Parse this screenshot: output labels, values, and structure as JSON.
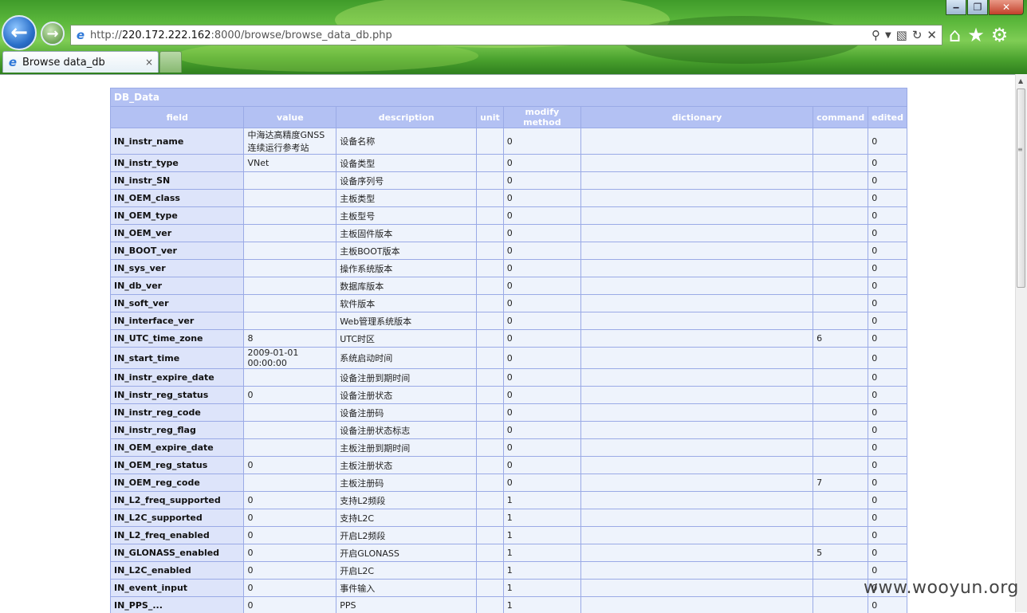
{
  "browser": {
    "url_prefix": "http://",
    "url_host": "220.172.222.162",
    "url_rest": ":8000/browse/browse_data_db.php",
    "tab_title": "Browse data_db",
    "tab_close": "×"
  },
  "table": {
    "caption": "DB_Data",
    "headers": [
      "field",
      "value",
      "description",
      "unit",
      "modify method",
      "dictionary",
      "command",
      "edited"
    ],
    "rows": [
      [
        "IN_instr_name",
        "中海达高精度GNSS连续运行参考站",
        "设备名称",
        "",
        "0",
        "",
        "",
        "0"
      ],
      [
        "IN_instr_type",
        "VNet",
        "设备类型",
        "",
        "0",
        "",
        "",
        "0"
      ],
      [
        "IN_instr_SN",
        "",
        "设备序列号",
        "",
        "0",
        "",
        "",
        "0"
      ],
      [
        "IN_OEM_class",
        "",
        "主板类型",
        "",
        "0",
        "",
        "",
        "0"
      ],
      [
        "IN_OEM_type",
        "",
        "主板型号",
        "",
        "0",
        "",
        "",
        "0"
      ],
      [
        "IN_OEM_ver",
        "",
        "主板固件版本",
        "",
        "0",
        "",
        "",
        "0"
      ],
      [
        "IN_BOOT_ver",
        "",
        "主板BOOT版本",
        "",
        "0",
        "",
        "",
        "0"
      ],
      [
        "IN_sys_ver",
        "",
        "操作系统版本",
        "",
        "0",
        "",
        "",
        "0"
      ],
      [
        "IN_db_ver",
        "",
        "数据库版本",
        "",
        "0",
        "",
        "",
        "0"
      ],
      [
        "IN_soft_ver",
        "",
        "软件版本",
        "",
        "0",
        "",
        "",
        "0"
      ],
      [
        "IN_interface_ver",
        "",
        "Web管理系统版本",
        "",
        "0",
        "",
        "",
        "0"
      ],
      [
        "IN_UTC_time_zone",
        "8",
        "UTC时区",
        "",
        "0",
        "",
        "6",
        "0"
      ],
      [
        "IN_start_time",
        "2009-01-01 00:00:00",
        "系统启动时间",
        "",
        "0",
        "",
        "",
        "0"
      ],
      [
        "IN_instr_expire_date",
        "",
        "设备注册到期时间",
        "",
        "0",
        "",
        "",
        "0"
      ],
      [
        "IN_instr_reg_status",
        "0",
        "设备注册状态",
        "",
        "0",
        "",
        "",
        "0"
      ],
      [
        "IN_instr_reg_code",
        "",
        "设备注册码",
        "",
        "0",
        "",
        "",
        "0"
      ],
      [
        "IN_instr_reg_flag",
        "",
        "设备注册状态标志",
        "",
        "0",
        "",
        "",
        "0"
      ],
      [
        "IN_OEM_expire_date",
        "",
        "主板注册到期时间",
        "",
        "0",
        "",
        "",
        "0"
      ],
      [
        "IN_OEM_reg_status",
        "0",
        "主板注册状态",
        "",
        "0",
        "",
        "",
        "0"
      ],
      [
        "IN_OEM_reg_code",
        "",
        "主板注册码",
        "",
        "0",
        "",
        "7",
        "0"
      ],
      [
        "IN_L2_freq_supported",
        "0",
        "支持L2频段",
        "",
        "1",
        "",
        "",
        "0"
      ],
      [
        "IN_L2C_supported",
        "0",
        "支持L2C",
        "",
        "1",
        "",
        "",
        "0"
      ],
      [
        "IN_L2_freq_enabled",
        "0",
        "开启L2频段",
        "",
        "1",
        "",
        "",
        "0"
      ],
      [
        "IN_GLONASS_enabled",
        "0",
        "开启GLONASS",
        "",
        "1",
        "",
        "5",
        "0"
      ],
      [
        "IN_L2C_enabled",
        "0",
        "开启L2C",
        "",
        "1",
        "",
        "",
        "0"
      ],
      [
        "IN_event_input",
        "0",
        "事件输入",
        "",
        "1",
        "",
        "",
        "0"
      ],
      [
        "IN_PPS_...",
        "0",
        "PPS",
        "",
        "1",
        "",
        "",
        "0"
      ]
    ]
  },
  "watermark": "www.wooyun.org"
}
